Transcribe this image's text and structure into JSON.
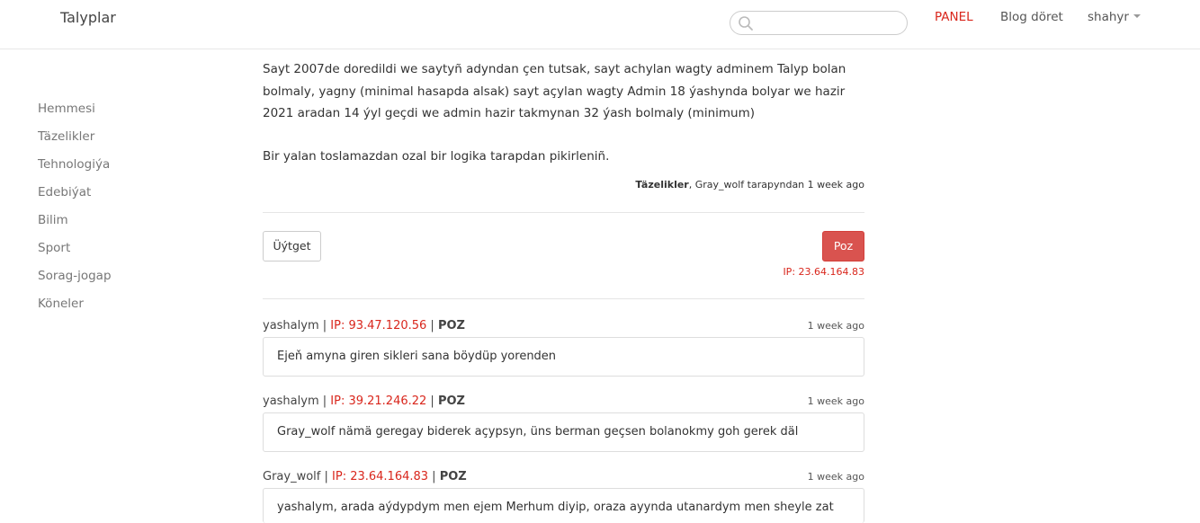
{
  "navbar": {
    "brand": "Talyplar",
    "search": {
      "value": "",
      "placeholder": ""
    },
    "panel": "PANEL",
    "blog": "Blog döret",
    "user": "shahyr"
  },
  "sidebar": {
    "items": [
      {
        "label": "Hemmesi"
      },
      {
        "label": "Täzelikler"
      },
      {
        "label": "Tehnologiýa"
      },
      {
        "label": "Edebiýat"
      },
      {
        "label": "Bilim"
      },
      {
        "label": "Sport"
      },
      {
        "label": "Sorag-jogap"
      },
      {
        "label": "Köneler"
      }
    ]
  },
  "post": {
    "paragraph1": "Sayt 2007de doredildi we saytyñ adyndan çen tutsak, sayt achylan wagty adminem Talyp bolan bolmaly, yagny (minimal hasapda alsak) sayt açylan wagty Admin 18 ýashynda bolyar we hazir 2021 aradan 14 ýyl geçdi we admin hazir takmynan 32 ýash bolmaly (minimum)",
    "paragraph2": "Bir yalan toslamazdan ozal bir logika tarapdan pikirleniñ.",
    "category": "Täzelikler",
    "byline": ", Gray_wolf tarapyndan 1 week ago",
    "edit_label": "Üýtget",
    "delete_label": "Poz",
    "ip": "IP: 23.64.164.83"
  },
  "comments": [
    {
      "author": "yashalym",
      "sep1": " | ",
      "ip": "IP: 93.47.120.56",
      "sep2": " | ",
      "poz": "POZ",
      "time": "1 week ago",
      "text": "Ejeň amyna giren sikleri sana böydüp yorenden"
    },
    {
      "author": "yashalym",
      "sep1": " | ",
      "ip": "IP: 39.21.246.22",
      "sep2": " | ",
      "poz": "POZ",
      "time": "1 week ago",
      "text": "Gray_wolf nämä geregay biderek açypsyn, üns berman geçsen bolanokmy goh gerek däl"
    },
    {
      "author": "Gray_wolf",
      "sep1": " | ",
      "ip": "IP: 23.64.164.83",
      "sep2": " | ",
      "poz": "POZ",
      "time": "1 week ago",
      "text": "yashalym, arada aýdypdym men ejem Merhum diyip, oraza ayynda utanardym men sheyle zat"
    }
  ]
}
